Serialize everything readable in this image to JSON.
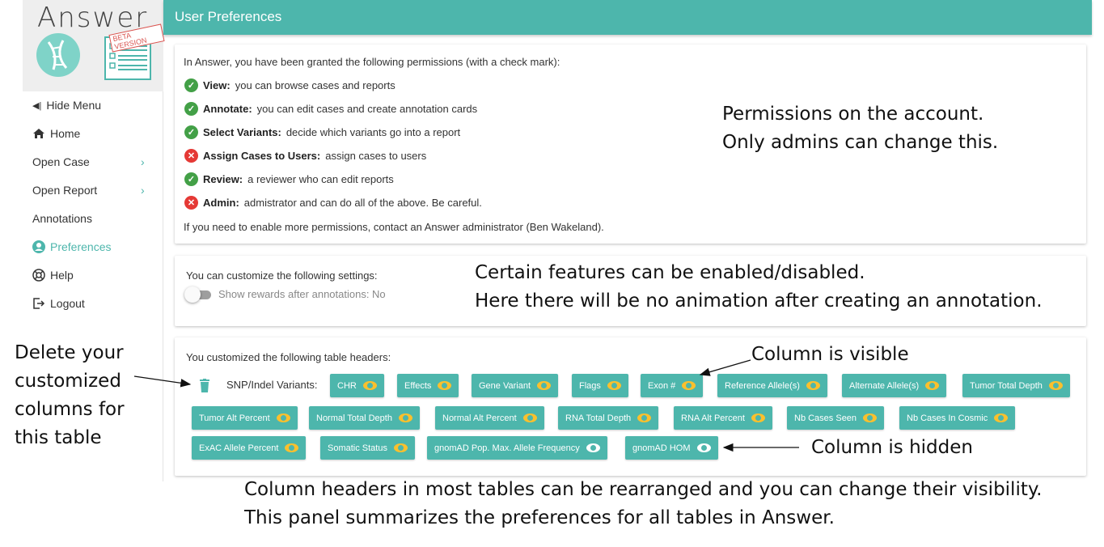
{
  "logo": {
    "text": "Answer",
    "badge": "BETA VERSION"
  },
  "sidebar": {
    "items": [
      {
        "label": "Hide Menu",
        "icon": "collapse-icon"
      },
      {
        "label": "Home",
        "icon": "home-icon"
      },
      {
        "label": "Open Case",
        "icon": "chevron-right-icon"
      },
      {
        "label": "Open Report",
        "icon": "chevron-right-icon"
      },
      {
        "label": "Annotations"
      },
      {
        "label": "Preferences",
        "icon": "account-icon",
        "active": true
      },
      {
        "label": "Help",
        "icon": "help-icon"
      },
      {
        "label": "Logout",
        "icon": "logout-icon"
      }
    ]
  },
  "header": {
    "title": "User Preferences"
  },
  "permissions": {
    "intro": "In Answer, you have been granted the following permissions (with a check mark):",
    "items": [
      {
        "name": "View:",
        "desc": "you can browse cases and reports",
        "granted": true
      },
      {
        "name": "Annotate:",
        "desc": "you can edit cases and create annotation cards",
        "granted": true
      },
      {
        "name": "Select Variants:",
        "desc": "decide which variants go into a report",
        "granted": true
      },
      {
        "name": "Assign Cases to Users:",
        "desc": "assign cases to users",
        "granted": false
      },
      {
        "name": "Review:",
        "desc": "a reviewer who can edit reports",
        "granted": true
      },
      {
        "name": "Admin:",
        "desc": "admistrator and can do all of the above. Be careful.",
        "granted": false
      }
    ],
    "footer": "If you need to enable more permissions, contact an Answer administrator (Ben Wakeland)."
  },
  "settings": {
    "title": "You can customize the following settings:",
    "toggle_label": "Show rewards after annotations: No"
  },
  "table_headers": {
    "title": "You customized the following table headers:",
    "table_name": "SNP/Indel Variants:",
    "chips": [
      {
        "label": "CHR",
        "visible": true
      },
      {
        "label": "Effects",
        "visible": true
      },
      {
        "label": "Gene Variant",
        "visible": true
      },
      {
        "label": "Flags",
        "visible": true
      },
      {
        "label": "Exon #",
        "visible": true
      },
      {
        "label": "Reference Allele(s)",
        "visible": true
      },
      {
        "label": "Alternate Allele(s)",
        "visible": true
      },
      {
        "label": "Tumor Total Depth",
        "visible": true
      },
      {
        "label": "Tumor Alt Percent",
        "visible": true
      },
      {
        "label": "Normal Total Depth",
        "visible": true
      },
      {
        "label": "Normal Alt Percent",
        "visible": true
      },
      {
        "label": "RNA Total Depth",
        "visible": true
      },
      {
        "label": "RNA Alt Percent",
        "visible": true
      },
      {
        "label": "Nb Cases Seen",
        "visible": true
      },
      {
        "label": "Nb Cases In Cosmic",
        "visible": true
      },
      {
        "label": "ExAC Allele Percent",
        "visible": true
      },
      {
        "label": "Somatic Status",
        "visible": true
      },
      {
        "label": "gnomAD Pop. Max. Allele Frequency",
        "visible": false
      },
      {
        "label": "gnomAD HOM",
        "visible": false
      }
    ]
  },
  "annotations": {
    "permissions_1": "Permissions on the account.",
    "permissions_2": "Only admins can change this.",
    "features_1": "Certain features can be enabled/disabled.",
    "features_2": "Here there will be no animation after creating an annotation.",
    "delete_1": "Delete your",
    "delete_2": "customized",
    "delete_3": "columns for",
    "delete_4": "this table",
    "visible": "Column is visible",
    "hidden": "Column is hidden",
    "bottom_1": "Column headers in most tables can be rearranged and you can change their visibility.",
    "bottom_2": "This panel summarizes the preferences for all tables in Answer."
  },
  "colors": {
    "accent": "#4db6ac",
    "eye_visible": "#fbc02d",
    "ok": "#43a047",
    "error": "#e53935"
  }
}
